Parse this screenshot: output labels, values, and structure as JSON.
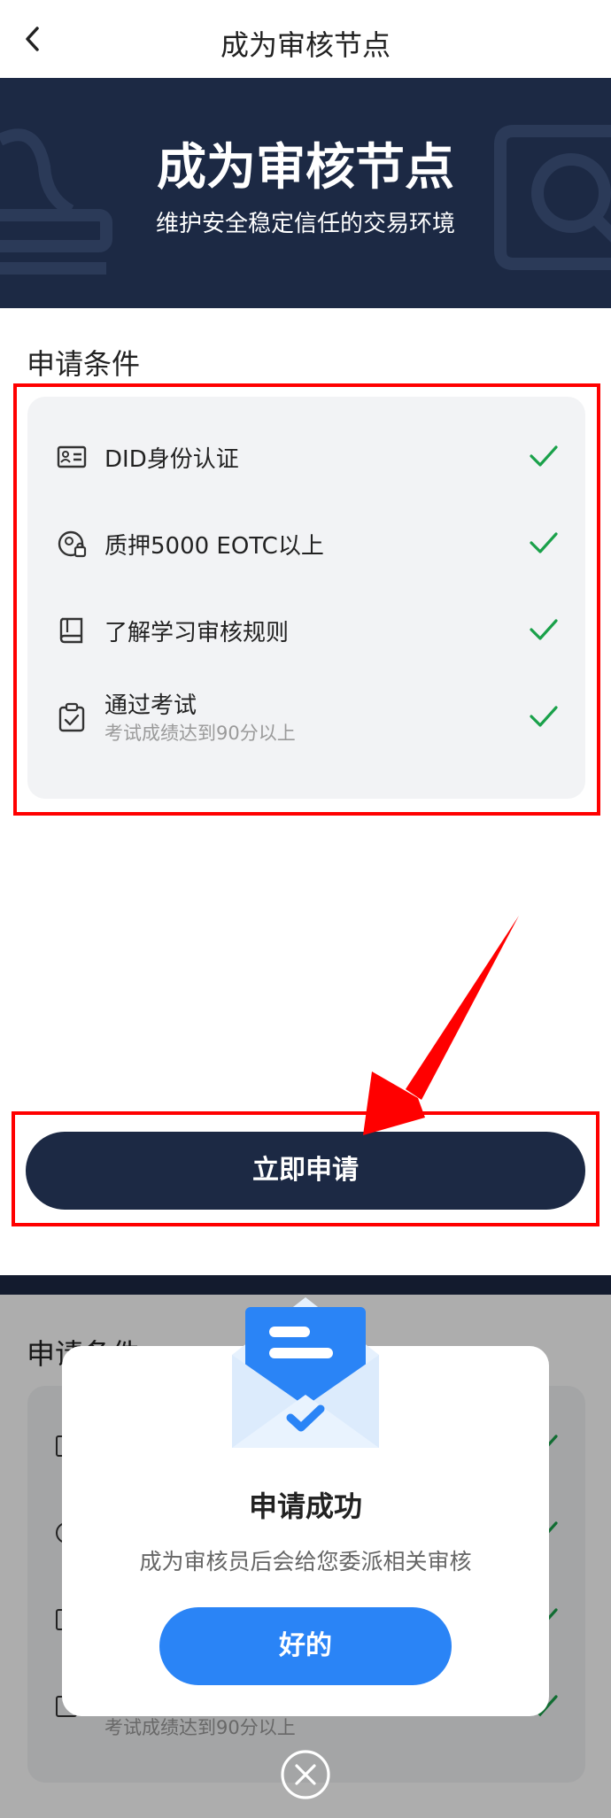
{
  "nav": {
    "title": "成为审核节点"
  },
  "banner": {
    "title": "成为审核节点",
    "subtitle": "维护安全稳定信任的交易环境"
  },
  "conditions": {
    "title": "申请条件",
    "items": [
      {
        "label": "DID身份认证",
        "icon": "id-card-icon"
      },
      {
        "label": "质押5000 EOTC以上",
        "icon": "pledge-icon"
      },
      {
        "label": "了解学习审核规则",
        "icon": "book-icon"
      },
      {
        "label": "通过考试",
        "sub": "考试成绩达到90分以上",
        "icon": "clipboard-check-icon"
      }
    ]
  },
  "apply_button": "立即申请",
  "modal": {
    "title": "申请成功",
    "message": "成为审核员后会给您委派相关审核",
    "ok": "好的"
  },
  "colors": {
    "navy": "#1c2944",
    "blue": "#2a84f6",
    "check_green": "#1aa14a",
    "highlight_red": "#ff0000"
  }
}
